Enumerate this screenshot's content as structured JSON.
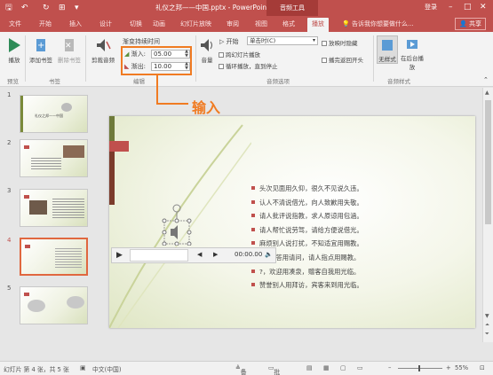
{
  "titlebar": {
    "doc_title": "礼仪之邦——中国.pptx - PowerPoint",
    "context_tab": "音频工具",
    "login": "登录",
    "accent_color": "#c0504d"
  },
  "tabs": [
    "文件",
    "开始",
    "插入",
    "设计",
    "切换",
    "动画",
    "幻灯片放映",
    "审阅",
    "视图",
    "格式",
    "播放"
  ],
  "tell_me": "告诉我你想要做什么...",
  "share": "共享",
  "ribbon": {
    "play_label": "播放",
    "add_bookmark": "添加书签",
    "remove_bookmark": "删除书签",
    "trim_audio": "剪裁音频",
    "fade_duration_label": "渐变持续时间",
    "fade_in_label": "渐入:",
    "fade_in_value": "05.00",
    "fade_out_label": "渐出:",
    "fade_out_value": "10.00",
    "volume_label": "音量",
    "start_label": "开始",
    "start_value": "单击时(C)",
    "play_across_slides": "跨幻灯片播放",
    "loop_until_stopped": "循环播放，直到停止",
    "hide_during_show": "放映时隐藏",
    "rewind_after_play": "播完返回开头",
    "no_style_label": "无样式",
    "play_in_bg_label": "在后台播放",
    "group_preview": "预览",
    "group_bookmarks": "书签",
    "group_editing": "编辑",
    "group_audio_options": "音频选项",
    "group_audio_styles": "音频样式"
  },
  "annotation": {
    "text": "输入"
  },
  "thumbnails": [
    {
      "num": "1",
      "title": "礼仪之邦——中国"
    },
    {
      "num": "2",
      "title": ""
    },
    {
      "num": "3",
      "title": ""
    },
    {
      "num": "4",
      "title": "",
      "selected": true
    },
    {
      "num": "5",
      "title": ""
    }
  ],
  "slide": {
    "bullets": [
      "头次见面用久仰，很久不见说久违。",
      "认人不清说借光，向人致歉用失敬。",
      "请人批评说指教，求人原谅用包涵。",
      "请人帮忙说劳驾，请给方便说借光。",
      "麻烦别人说打扰，不知适宜用赐教。",
      "?，解答用请问，请人指点用赐教。",
      "?，欢迎用凑泉，赠客自我用光临。",
      "赞誉别人用拜访，宾客来到用光临。"
    ],
    "media_time": "00:00.00"
  },
  "statusbar": {
    "slide_info": "幻灯片 第 4 张，共 5 张",
    "language": "中文(中国)",
    "notes": "备注",
    "comments": "批注",
    "zoom": "55%"
  }
}
